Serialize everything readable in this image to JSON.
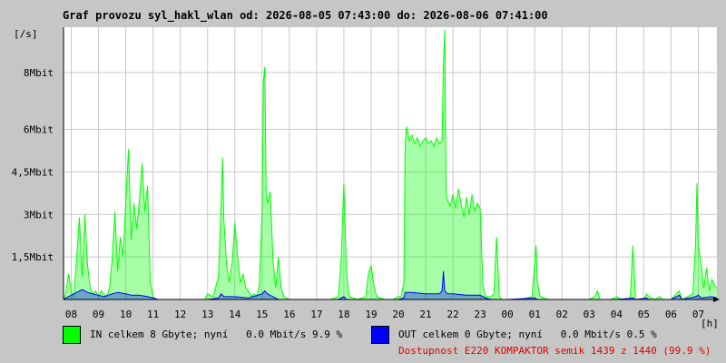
{
  "colors": {
    "background": "#c6c6c6",
    "plot_bg": "#ffffff",
    "grid": "#c8c8c8",
    "in_series": "#00ff00",
    "out_series": "#0000ff",
    "availability_text": "#e00000"
  },
  "chart_data": {
    "type": "area",
    "title": "Graf provozu syl_hakl_wlan od: 2026-08-05 07:43:00 do: 2026-08-06 07:41:00",
    "ylabel": "[/s]",
    "xlabel": "[h]",
    "ylim": [
      0,
      9.6
    ],
    "y_unit": "Mbit",
    "y_ticks": [
      {
        "value": 1.5,
        "label": "1,5Mbit"
      },
      {
        "value": 3,
        "label": "3Mbit"
      },
      {
        "value": 4.5,
        "label": "4,5Mbit"
      },
      {
        "value": 6,
        "label": "6Mbit"
      },
      {
        "value": 8,
        "label": "8Mbit"
      }
    ],
    "xlim": [
      7.717,
      31.683
    ],
    "x_ticks": [
      {
        "value": 8,
        "label": "08"
      },
      {
        "value": 9,
        "label": "09"
      },
      {
        "value": 10,
        "label": "10"
      },
      {
        "value": 11,
        "label": "11"
      },
      {
        "value": 12,
        "label": "12"
      },
      {
        "value": 13,
        "label": "13"
      },
      {
        "value": 14,
        "label": "14"
      },
      {
        "value": 15,
        "label": "15"
      },
      {
        "value": 16,
        "label": "16"
      },
      {
        "value": 17,
        "label": "17"
      },
      {
        "value": 18,
        "label": "18"
      },
      {
        "value": 19,
        "label": "19"
      },
      {
        "value": 20,
        "label": "20"
      },
      {
        "value": 21,
        "label": "21"
      },
      {
        "value": 22,
        "label": "22"
      },
      {
        "value": 23,
        "label": "23"
      },
      {
        "value": 24,
        "label": "00"
      },
      {
        "value": 25,
        "label": "01"
      },
      {
        "value": 26,
        "label": "02"
      },
      {
        "value": 27,
        "label": "03"
      },
      {
        "value": 28,
        "label": "04"
      },
      {
        "value": 29,
        "label": "05"
      },
      {
        "value": 30,
        "label": "06"
      },
      {
        "value": 31,
        "label": "07"
      }
    ],
    "grid": true,
    "series": [
      {
        "name": "IN",
        "points": [
          [
            7.72,
            0
          ],
          [
            7.8,
            0.2
          ],
          [
            7.9,
            0.9
          ],
          [
            8.0,
            0.3
          ],
          [
            8.1,
            0.1
          ],
          [
            8.2,
            1.5
          ],
          [
            8.3,
            2.9
          ],
          [
            8.4,
            0.8
          ],
          [
            8.5,
            3.0
          ],
          [
            8.6,
            1.2
          ],
          [
            8.7,
            0.4
          ],
          [
            8.8,
            0.2
          ],
          [
            8.9,
            0.3
          ],
          [
            9.0,
            0.1
          ],
          [
            9.1,
            0.3
          ],
          [
            9.2,
            0.2
          ],
          [
            9.3,
            0.1
          ],
          [
            9.4,
            0.4
          ],
          [
            9.5,
            1.4
          ],
          [
            9.6,
            3.1
          ],
          [
            9.7,
            1.0
          ],
          [
            9.8,
            2.2
          ],
          [
            9.9,
            1.5
          ],
          [
            10.0,
            3.5
          ],
          [
            10.1,
            5.3
          ],
          [
            10.2,
            2.1
          ],
          [
            10.3,
            3.4
          ],
          [
            10.4,
            2.5
          ],
          [
            10.5,
            3.5
          ],
          [
            10.6,
            4.8
          ],
          [
            10.7,
            3.1
          ],
          [
            10.8,
            4.0
          ],
          [
            10.9,
            0.6
          ],
          [
            11.0,
            0.1
          ],
          [
            11.1,
            0
          ],
          [
            11.5,
            0
          ],
          [
            12.0,
            0
          ],
          [
            12.5,
            0
          ],
          [
            12.9,
            0
          ],
          [
            13.0,
            0.2
          ],
          [
            13.2,
            0.1
          ],
          [
            13.4,
            0.8
          ],
          [
            13.5,
            3.4
          ],
          [
            13.55,
            5.0
          ],
          [
            13.6,
            2.8
          ],
          [
            13.7,
            1.2
          ],
          [
            13.8,
            0.6
          ],
          [
            13.9,
            1.3
          ],
          [
            14.0,
            2.7
          ],
          [
            14.1,
            1.5
          ],
          [
            14.2,
            0.6
          ],
          [
            14.3,
            0.9
          ],
          [
            14.4,
            0.4
          ],
          [
            14.5,
            0.3
          ],
          [
            14.6,
            0.1
          ],
          [
            14.7,
            0.2
          ],
          [
            14.8,
            0.1
          ],
          [
            14.9,
            0.5
          ],
          [
            15.0,
            3.1
          ],
          [
            15.05,
            7.7
          ],
          [
            15.1,
            8.2
          ],
          [
            15.15,
            3.7
          ],
          [
            15.2,
            3.4
          ],
          [
            15.3,
            3.8
          ],
          [
            15.4,
            1.4
          ],
          [
            15.5,
            0.4
          ],
          [
            15.6,
            1.5
          ],
          [
            15.7,
            0.4
          ],
          [
            15.8,
            0.1
          ],
          [
            16.0,
            0
          ],
          [
            16.5,
            0
          ],
          [
            17.0,
            0
          ],
          [
            17.5,
            0
          ],
          [
            17.8,
            0.1
          ],
          [
            17.9,
            1.4
          ],
          [
            18.0,
            4.1
          ],
          [
            18.1,
            0.9
          ],
          [
            18.2,
            0.1
          ],
          [
            18.5,
            0
          ],
          [
            18.8,
            0.1
          ],
          [
            18.9,
            0.9
          ],
          [
            19.0,
            1.2
          ],
          [
            19.1,
            0.5
          ],
          [
            19.2,
            0.1
          ],
          [
            19.5,
            0
          ],
          [
            19.8,
            0
          ],
          [
            20.0,
            0.1
          ],
          [
            20.1,
            0.1
          ],
          [
            20.2,
            0.6
          ],
          [
            20.25,
            5.5
          ],
          [
            20.3,
            6.1
          ],
          [
            20.4,
            5.6
          ],
          [
            20.5,
            5.8
          ],
          [
            20.6,
            5.5
          ],
          [
            20.7,
            5.7
          ],
          [
            20.8,
            5.4
          ],
          [
            20.9,
            5.6
          ],
          [
            21.0,
            5.7
          ],
          [
            21.1,
            5.5
          ],
          [
            21.2,
            5.6
          ],
          [
            21.3,
            5.4
          ],
          [
            21.4,
            5.7
          ],
          [
            21.5,
            5.5
          ],
          [
            21.6,
            5.6
          ],
          [
            21.65,
            8.3
          ],
          [
            21.7,
            9.5
          ],
          [
            21.75,
            3.8
          ],
          [
            21.8,
            3.5
          ],
          [
            21.9,
            3.3
          ],
          [
            22.0,
            3.7
          ],
          [
            22.1,
            3.2
          ],
          [
            22.2,
            3.9
          ],
          [
            22.3,
            3.4
          ],
          [
            22.4,
            2.9
          ],
          [
            22.5,
            3.6
          ],
          [
            22.6,
            3.0
          ],
          [
            22.7,
            3.7
          ],
          [
            22.8,
            3.1
          ],
          [
            22.9,
            3.4
          ],
          [
            23.0,
            3.2
          ],
          [
            23.1,
            0.5
          ],
          [
            23.2,
            0.1
          ],
          [
            23.4,
            0.1
          ],
          [
            23.5,
            0.2
          ],
          [
            23.6,
            2.2
          ],
          [
            23.7,
            0.1
          ],
          [
            23.8,
            0
          ],
          [
            24.0,
            0
          ],
          [
            24.5,
            0
          ],
          [
            24.9,
            0.1
          ],
          [
            25.0,
            1.3
          ],
          [
            25.05,
            1.9
          ],
          [
            25.1,
            0.6
          ],
          [
            25.2,
            0.1
          ],
          [
            25.5,
            0
          ],
          [
            26.0,
            0
          ],
          [
            26.5,
            0
          ],
          [
            27.0,
            0
          ],
          [
            27.2,
            0.1
          ],
          [
            27.3,
            0.3
          ],
          [
            27.4,
            0
          ],
          [
            27.8,
            0
          ],
          [
            28.0,
            0.1
          ],
          [
            28.2,
            0
          ],
          [
            28.5,
            0
          ],
          [
            28.6,
            1.9
          ],
          [
            28.7,
            0
          ],
          [
            29.0,
            0
          ],
          [
            29.1,
            0.2
          ],
          [
            29.2,
            0.1
          ],
          [
            29.4,
            0
          ],
          [
            29.6,
            0.1
          ],
          [
            29.7,
            0
          ],
          [
            30.0,
            0
          ],
          [
            30.3,
            0.3
          ],
          [
            30.4,
            0
          ],
          [
            30.6,
            0.1
          ],
          [
            30.8,
            0.2
          ],
          [
            30.9,
            2.0
          ],
          [
            30.95,
            4.1
          ],
          [
            31.0,
            1.9
          ],
          [
            31.1,
            1.3
          ],
          [
            31.2,
            0.4
          ],
          [
            31.3,
            1.1
          ],
          [
            31.4,
            0.3
          ],
          [
            31.5,
            0.7
          ],
          [
            31.6,
            0.5
          ],
          [
            31.68,
            0.4
          ]
        ]
      },
      {
        "name": "OUT",
        "points": [
          [
            7.72,
            0
          ],
          [
            7.8,
            0.05
          ],
          [
            8.0,
            0.15
          ],
          [
            8.2,
            0.25
          ],
          [
            8.4,
            0.35
          ],
          [
            8.5,
            0.3
          ],
          [
            8.6,
            0.25
          ],
          [
            8.8,
            0.2
          ],
          [
            9.0,
            0.15
          ],
          [
            9.2,
            0.1
          ],
          [
            9.5,
            0.2
          ],
          [
            9.7,
            0.25
          ],
          [
            10.0,
            0.2
          ],
          [
            10.2,
            0.15
          ],
          [
            10.5,
            0.15
          ],
          [
            10.8,
            0.1
          ],
          [
            11.0,
            0.05
          ],
          [
            11.2,
            0
          ],
          [
            12.0,
            0
          ],
          [
            13.0,
            0
          ],
          [
            13.4,
            0.05
          ],
          [
            13.5,
            0.2
          ],
          [
            13.6,
            0.1
          ],
          [
            14.0,
            0.1
          ],
          [
            14.5,
            0.05
          ],
          [
            15.0,
            0.2
          ],
          [
            15.1,
            0.3
          ],
          [
            15.2,
            0.2
          ],
          [
            15.4,
            0.1
          ],
          [
            15.6,
            0
          ],
          [
            16.0,
            0
          ],
          [
            17.0,
            0
          ],
          [
            17.8,
            0
          ],
          [
            17.9,
            0.05
          ],
          [
            18.0,
            0.1
          ],
          [
            18.1,
            0
          ],
          [
            19.0,
            0
          ],
          [
            19.5,
            0
          ],
          [
            20.0,
            0
          ],
          [
            20.2,
            0.05
          ],
          [
            20.25,
            0.25
          ],
          [
            20.5,
            0.25
          ],
          [
            21.0,
            0.2
          ],
          [
            21.5,
            0.2
          ],
          [
            21.6,
            0.3
          ],
          [
            21.65,
            1.0
          ],
          [
            21.7,
            0.3
          ],
          [
            21.8,
            0.2
          ],
          [
            22.0,
            0.2
          ],
          [
            22.5,
            0.15
          ],
          [
            23.0,
            0.15
          ],
          [
            23.2,
            0.05
          ],
          [
            23.4,
            0
          ],
          [
            24.0,
            0
          ],
          [
            25.0,
            0.05
          ],
          [
            25.1,
            0
          ],
          [
            26.0,
            0
          ],
          [
            27.0,
            0
          ],
          [
            28.0,
            0
          ],
          [
            28.6,
            0.05
          ],
          [
            28.7,
            0
          ],
          [
            29.1,
            0.05
          ],
          [
            29.2,
            0
          ],
          [
            30.0,
            0
          ],
          [
            30.3,
            0.15
          ],
          [
            30.4,
            0
          ],
          [
            30.9,
            0.1
          ],
          [
            31.0,
            0.15
          ],
          [
            31.1,
            0.05
          ],
          [
            31.5,
            0.1
          ],
          [
            31.68,
            0.05
          ]
        ]
      }
    ]
  },
  "legend": {
    "in_text": "IN celkem 8 Gbyte; nyní   0.0 Mbit/s 9.9 %",
    "out_text": "OUT celkem 0 Gbyte; nyní   0.0 Mbit/s 0.5 %"
  },
  "availability": "Dostupnost E220 KOMPAKTOR semik 1439 z 1440 (99.9 %)"
}
